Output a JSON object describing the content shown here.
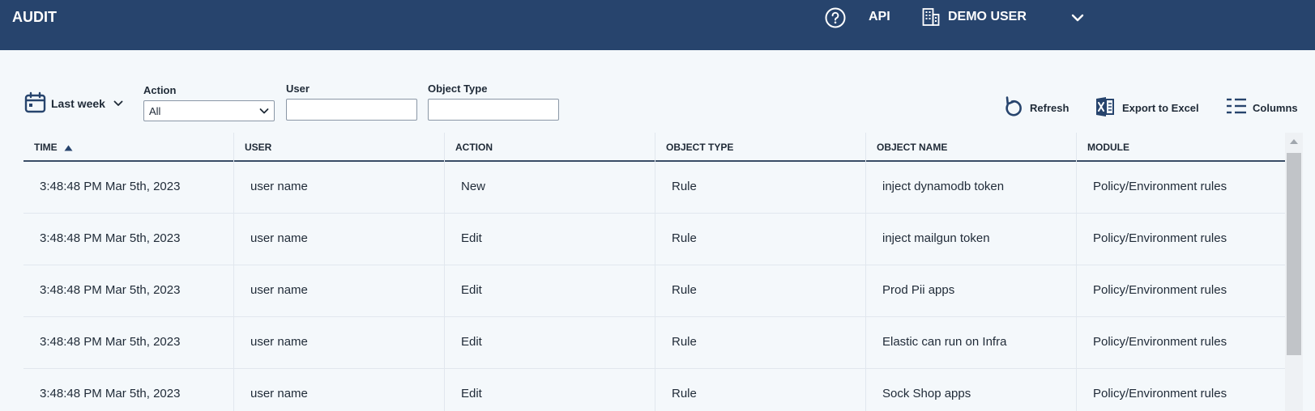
{
  "header": {
    "title": "AUDIT",
    "api_label": "API",
    "user_label": "DEMO USER",
    "icons": {
      "help": "help-circle-icon",
      "org": "building-icon",
      "menu": "chevron-down-icon"
    },
    "colors": {
      "bar": "#27446d",
      "text": "#ffffff"
    }
  },
  "filters": {
    "date_range": "Last week",
    "action": {
      "label": "Action",
      "value": "All"
    },
    "user": {
      "label": "User",
      "value": "",
      "placeholder": ""
    },
    "object_type": {
      "label": "Object Type",
      "value": "",
      "placeholder": ""
    }
  },
  "toolbar": {
    "refresh": "Refresh",
    "export": "Export to Excel",
    "columns": "Columns"
  },
  "table": {
    "columns": [
      "TIME",
      "USER",
      "ACTION",
      "OBJECT TYPE",
      "OBJECT NAME",
      "MODULE"
    ],
    "sort": {
      "column": "TIME",
      "direction": "ascending"
    },
    "rows": [
      [
        "3:48:48 PM Mar 5th, 2023",
        "user name",
        "New",
        "Rule",
        "inject dynamodb token",
        "Policy/Environment rules"
      ],
      [
        "3:48:48 PM Mar 5th, 2023",
        "user name",
        "Edit",
        "Rule",
        "inject mailgun token",
        "Policy/Environment rules"
      ],
      [
        "3:48:48 PM Mar 5th, 2023",
        "user name",
        "Edit",
        "Rule",
        "Prod Pii apps",
        "Policy/Environment rules"
      ],
      [
        "3:48:48 PM Mar 5th, 2023",
        "user name",
        "Edit",
        "Rule",
        "Elastic can run on Infra",
        "Policy/Environment rules"
      ],
      [
        "3:48:48 PM Mar 5th, 2023",
        "user name",
        "Edit",
        "Rule",
        "Sock Shop apps",
        "Policy/Environment rules"
      ]
    ]
  }
}
